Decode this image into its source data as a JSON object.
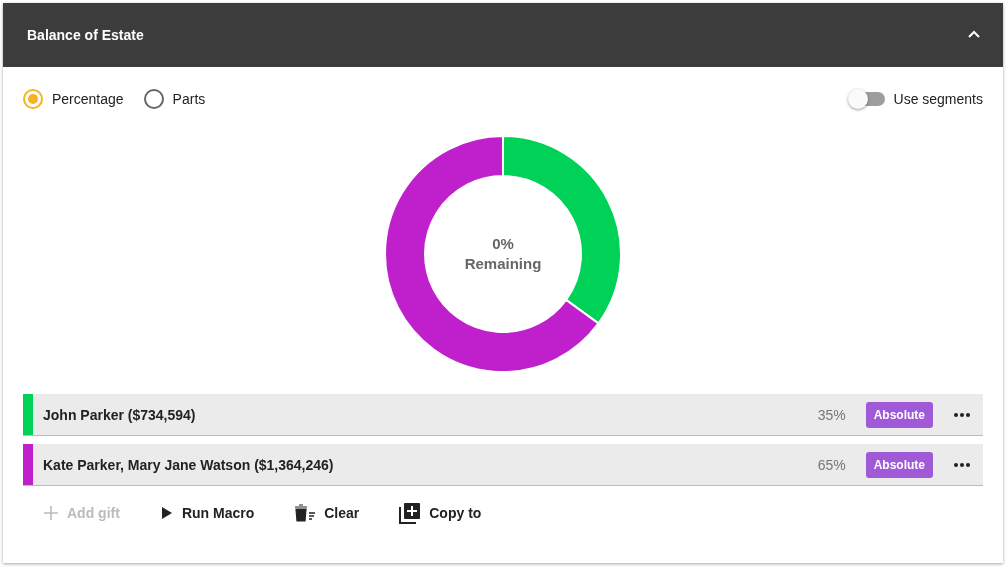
{
  "header": {
    "title": "Balance of Estate",
    "expanded": true
  },
  "modes": [
    {
      "label": "Percentage",
      "selected": true
    },
    {
      "label": "Parts",
      "selected": false
    }
  ],
  "segments_toggle": {
    "label": "Use segments",
    "on": false
  },
  "donut": {
    "value_text": "0%",
    "caption": "Remaining",
    "chart_data": {
      "type": "donut",
      "values": [
        35,
        65
      ]
    }
  },
  "gifts": [
    {
      "label": "John Parker ($734,594)",
      "color": "#00d157",
      "percent": "35%",
      "badge": "Absolute"
    },
    {
      "label": "Kate Parker, Mary Jane Watson ($1,364,246)",
      "color": "#c020cc",
      "percent": "65%",
      "badge": "Absolute"
    }
  ],
  "actions": [
    {
      "kind": "add",
      "label": "Add gift",
      "disabled": true
    },
    {
      "kind": "run",
      "label": "Run Macro",
      "disabled": false
    },
    {
      "kind": "clear",
      "label": "Clear",
      "disabled": false
    },
    {
      "kind": "copy",
      "label": "Copy to",
      "disabled": false
    }
  ]
}
